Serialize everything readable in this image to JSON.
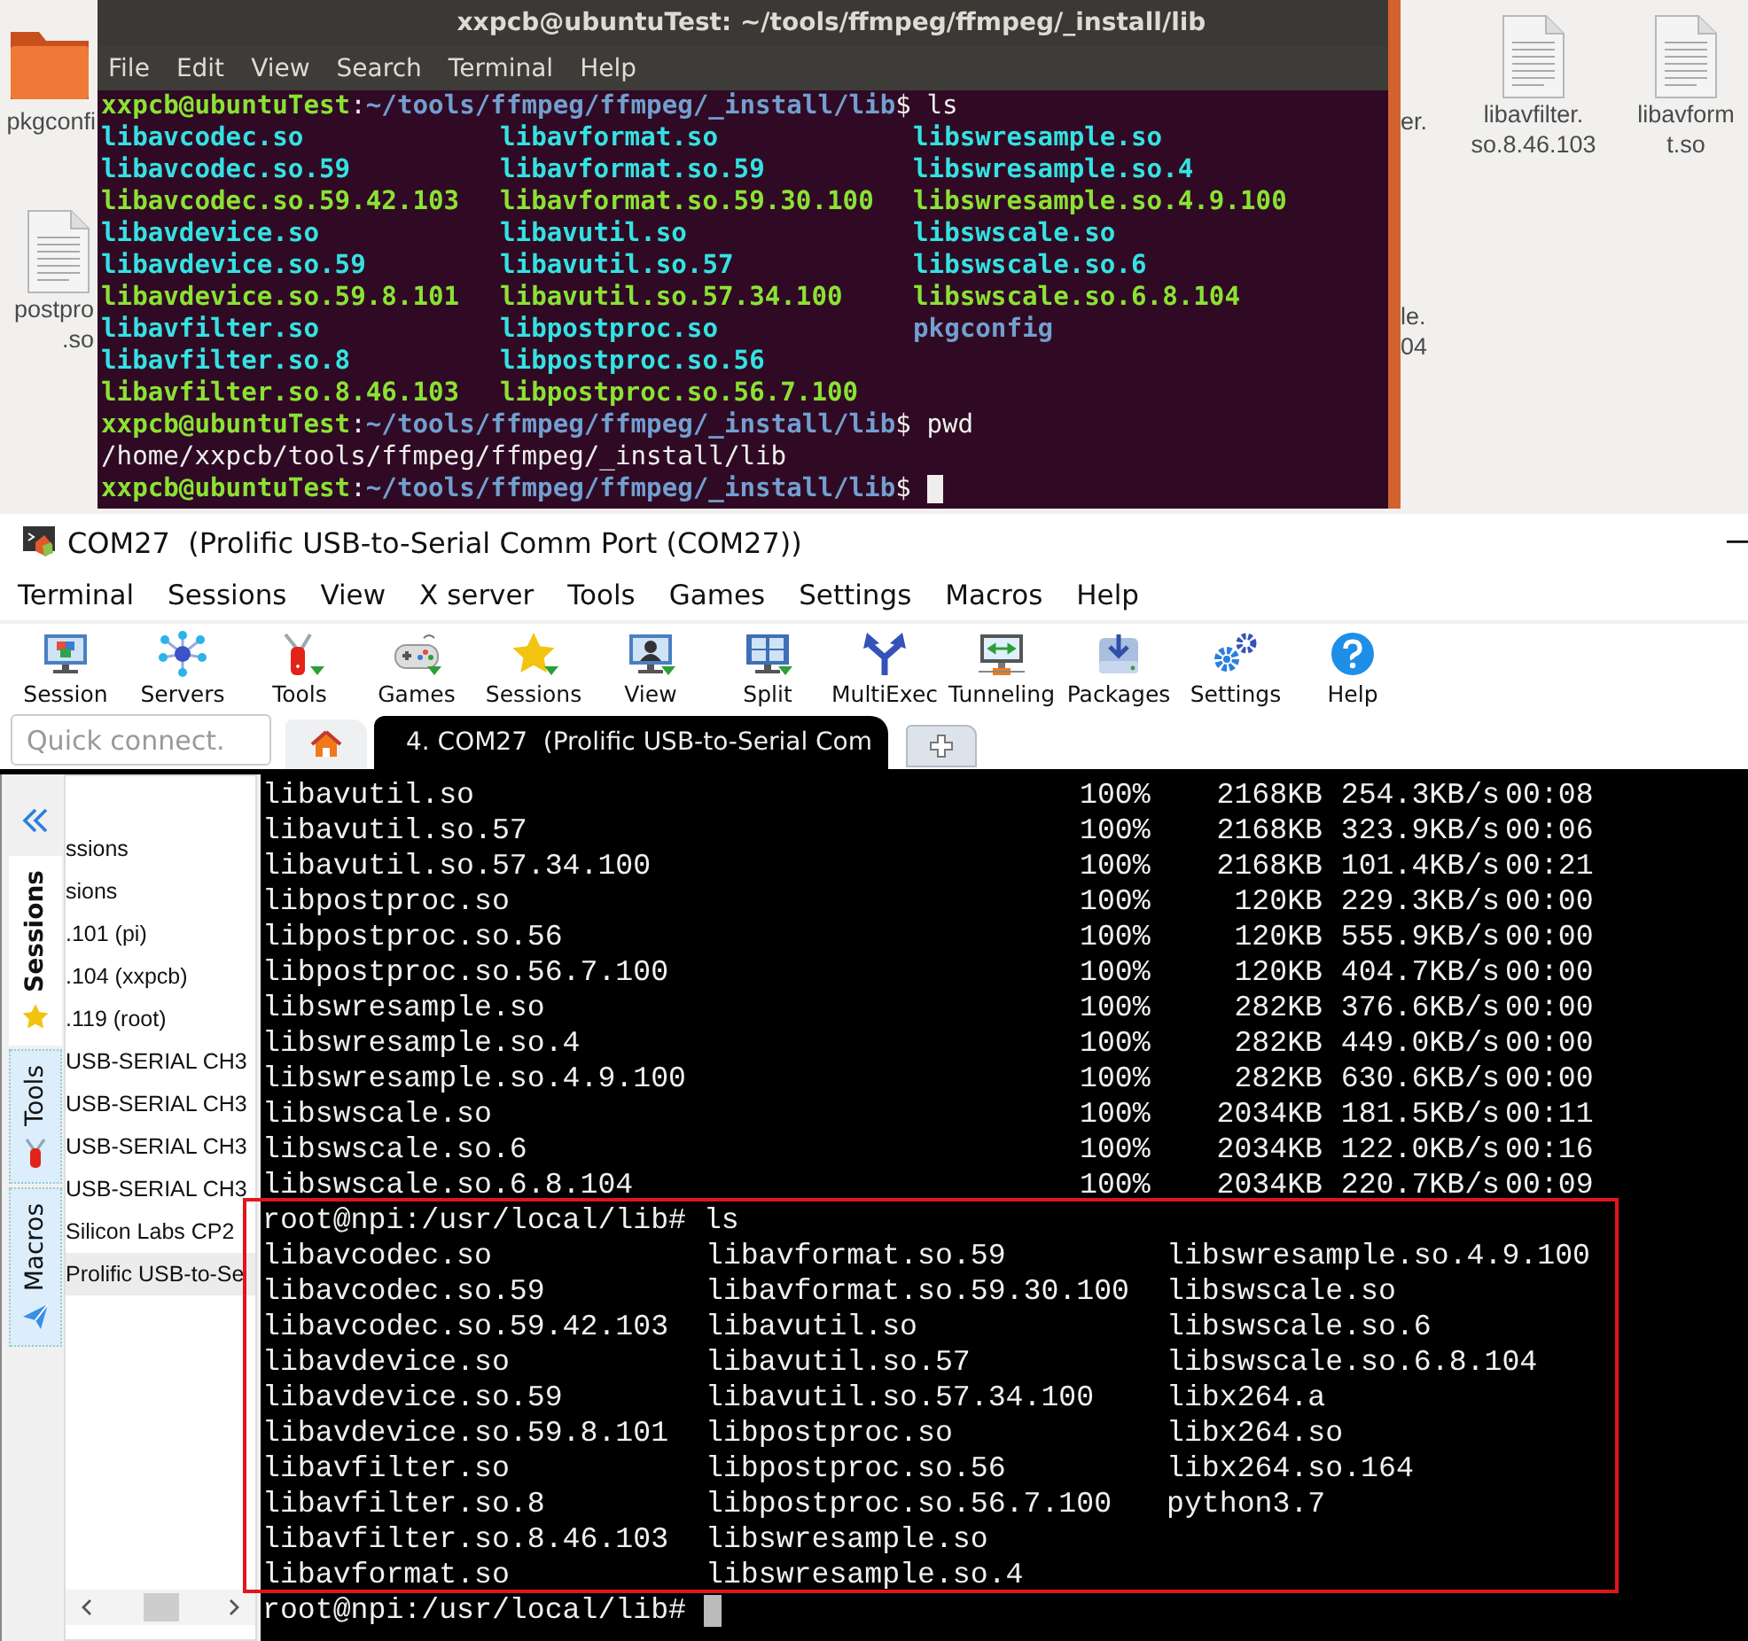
{
  "desktop": {
    "icons": [
      {
        "kind": "folder",
        "lines": [
          "pkgconfi"
        ]
      },
      {
        "kind": "file",
        "lines": [
          "postpro",
          ".so"
        ]
      },
      {
        "kind": "label",
        "lines": [
          "er."
        ]
      },
      {
        "kind": "label",
        "lines": [
          "le.",
          "04"
        ]
      },
      {
        "kind": "file",
        "lines": [
          "libavfilter.",
          "so.8.46.103"
        ]
      },
      {
        "kind": "file",
        "lines": [
          "libavform",
          "t.so"
        ]
      }
    ]
  },
  "ubuntu_terminal": {
    "title": "xxpcb@ubuntuTest: ~/tools/ffmpeg/ffmpeg/_install/lib",
    "menu": [
      "File",
      "Edit",
      "View",
      "Search",
      "Terminal",
      "Help"
    ],
    "lines": [
      {
        "kind": "prompt",
        "segments": [
          {
            "kind": "user",
            "text": "xxpcb@ubuntuTest"
          },
          {
            "kind": "plain",
            "text": ":"
          },
          {
            "kind": "path",
            "text": "~/tools/ffmpeg/ffmpeg/_install/lib"
          },
          {
            "kind": "plain",
            "text": "$ ls"
          }
        ]
      },
      {
        "kind": "files",
        "entries": [
          {
            "name": "libavcodec.so",
            "kind": "link"
          },
          {
            "name": "libavformat.so",
            "kind": "link"
          },
          {
            "name": "libswresample.so",
            "kind": "link"
          }
        ]
      },
      {
        "kind": "files",
        "entries": [
          {
            "name": "libavcodec.so.59",
            "kind": "link"
          },
          {
            "name": "libavformat.so.59",
            "kind": "link"
          },
          {
            "name": "libswresample.so.4",
            "kind": "link"
          }
        ]
      },
      {
        "kind": "files",
        "entries": [
          {
            "name": "libavcodec.so.59.42.103",
            "kind": "file"
          },
          {
            "name": "libavformat.so.59.30.100",
            "kind": "file"
          },
          {
            "name": "libswresample.so.4.9.100",
            "kind": "file"
          }
        ]
      },
      {
        "kind": "files",
        "entries": [
          {
            "name": "libavdevice.so",
            "kind": "link"
          },
          {
            "name": "libavutil.so",
            "kind": "link"
          },
          {
            "name": "libswscale.so",
            "kind": "link"
          }
        ]
      },
      {
        "kind": "files",
        "entries": [
          {
            "name": "libavdevice.so.59",
            "kind": "link"
          },
          {
            "name": "libavutil.so.57",
            "kind": "link"
          },
          {
            "name": "libswscale.so.6",
            "kind": "link"
          }
        ]
      },
      {
        "kind": "files",
        "entries": [
          {
            "name": "libavdevice.so.59.8.101",
            "kind": "file"
          },
          {
            "name": "libavutil.so.57.34.100",
            "kind": "file"
          },
          {
            "name": "libswscale.so.6.8.104",
            "kind": "file"
          }
        ]
      },
      {
        "kind": "files",
        "entries": [
          {
            "name": "libavfilter.so",
            "kind": "link"
          },
          {
            "name": "libpostproc.so",
            "kind": "link"
          },
          {
            "name": "pkgconfig",
            "kind": "dir"
          }
        ]
      },
      {
        "kind": "files",
        "entries": [
          {
            "name": "libavfilter.so.8",
            "kind": "link"
          },
          {
            "name": "libpostproc.so.56",
            "kind": "link"
          }
        ]
      },
      {
        "kind": "files",
        "entries": [
          {
            "name": "libavfilter.so.8.46.103",
            "kind": "file"
          },
          {
            "name": "libpostproc.so.56.7.100",
            "kind": "file"
          }
        ]
      },
      {
        "kind": "prompt",
        "segments": [
          {
            "kind": "user",
            "text": "xxpcb@ubuntuTest"
          },
          {
            "kind": "plain",
            "text": ":"
          },
          {
            "kind": "path",
            "text": "~/tools/ffmpeg/ffmpeg/_install/lib"
          },
          {
            "kind": "plain",
            "text": "$ pwd"
          }
        ]
      },
      {
        "kind": "output",
        "text": "/home/xxpcb/tools/ffmpeg/ffmpeg/_install/lib"
      },
      {
        "kind": "prompt",
        "cursor": true,
        "segments": [
          {
            "kind": "user",
            "text": "xxpcb@ubuntuTest"
          },
          {
            "kind": "plain",
            "text": ":"
          },
          {
            "kind": "path",
            "text": "~/tools/ffmpeg/ffmpeg/_install/lib"
          },
          {
            "kind": "plain",
            "text": "$"
          }
        ]
      }
    ]
  },
  "mobaxterm": {
    "title": "COM27  (Prolific USB-to-Serial Comm Port (COM27))",
    "menu": [
      "Terminal",
      "Sessions",
      "View",
      "X server",
      "Tools",
      "Games",
      "Settings",
      "Macros",
      "Help"
    ],
    "toolbar": [
      "Session",
      "Servers",
      "Tools",
      "Games",
      "Sessions",
      "View",
      "Split",
      "MultiExec",
      "Tunneling",
      "Packages",
      "Settings",
      "Help"
    ],
    "quick_connect": {
      "placeholder": "Quick connect."
    },
    "tabs": [
      {
        "kind": "home",
        "selected": false
      },
      {
        "kind": "session",
        "label": "4. COM27  (Prolific USB-to-Serial Com",
        "selected": true
      }
    ],
    "side_tabs": [
      {
        "label": "Sessions",
        "selected": true
      },
      {
        "label": "Tools",
        "selected": false
      },
      {
        "label": "Macros",
        "selected": false
      }
    ],
    "sessions": [
      {
        "label": "ssions",
        "selected": false
      },
      {
        "label": "sions",
        "selected": false
      },
      {
        "label": ".101 (pi)",
        "selected": false
      },
      {
        "label": ".104 (xxpcb)",
        "selected": false
      },
      {
        "label": ".119 (root)",
        "selected": false
      },
      {
        "label": "USB-SERIAL CH3",
        "selected": false
      },
      {
        "label": "USB-SERIAL CH3",
        "selected": false
      },
      {
        "label": "USB-SERIAL CH3",
        "selected": false
      },
      {
        "label": "USB-SERIAL CH3",
        "selected": false
      },
      {
        "label": "Silicon Labs CP2",
        "selected": false
      },
      {
        "label": "Prolific USB-to-Se",
        "selected": true
      }
    ],
    "terminal": {
      "lines": [
        {
          "kind": "transfer",
          "cells": [
            "libavutil.so",
            "100%",
            "2168KB",
            "254.3KB/s",
            "00:08"
          ]
        },
        {
          "kind": "transfer",
          "cells": [
            "libavutil.so.57",
            "100%",
            "2168KB",
            "323.9KB/s",
            "00:06"
          ]
        },
        {
          "kind": "transfer",
          "cells": [
            "libavutil.so.57.34.100",
            "100%",
            "2168KB",
            "101.4KB/s",
            "00:21"
          ]
        },
        {
          "kind": "transfer",
          "cells": [
            "libpostproc.so",
            "100%",
            "120KB",
            "229.3KB/s",
            "00:00"
          ]
        },
        {
          "kind": "transfer",
          "cells": [
            "libpostproc.so.56",
            "100%",
            "120KB",
            "555.9KB/s",
            "00:00"
          ]
        },
        {
          "kind": "transfer",
          "cells": [
            "libpostproc.so.56.7.100",
            "100%",
            "120KB",
            "404.7KB/s",
            "00:00"
          ]
        },
        {
          "kind": "transfer",
          "cells": [
            "libswresample.so",
            "100%",
            "282KB",
            "376.6KB/s",
            "00:00"
          ]
        },
        {
          "kind": "transfer",
          "cells": [
            "libswresample.so.4",
            "100%",
            "282KB",
            "449.0KB/s",
            "00:00"
          ]
        },
        {
          "kind": "transfer",
          "cells": [
            "libswresample.so.4.9.100",
            "100%",
            "282KB",
            "630.6KB/s",
            "00:00"
          ]
        },
        {
          "kind": "transfer",
          "cells": [
            "libswscale.so",
            "100%",
            "2034KB",
            "181.5KB/s",
            "00:11"
          ]
        },
        {
          "kind": "transfer",
          "cells": [
            "libswscale.so.6",
            "100%",
            "2034KB",
            "122.0KB/s",
            "00:16"
          ]
        },
        {
          "kind": "transfer",
          "cells": [
            "libswscale.so.6.8.104",
            "100%",
            "2034KB",
            "220.7KB/s",
            "00:09"
          ]
        },
        {
          "kind": "prompt",
          "text": "root@npi:/usr/local/lib# ls"
        },
        {
          "kind": "files",
          "entries": [
            "libavcodec.so",
            "libavformat.so.59",
            "libswresample.so.4.9.100"
          ]
        },
        {
          "kind": "files",
          "entries": [
            "libavcodec.so.59",
            "libavformat.so.59.30.100",
            "libswscale.so"
          ]
        },
        {
          "kind": "files",
          "entries": [
            "libavcodec.so.59.42.103",
            "libavutil.so",
            "libswscale.so.6"
          ]
        },
        {
          "kind": "files",
          "entries": [
            "libavdevice.so",
            "libavutil.so.57",
            "libswscale.so.6.8.104"
          ]
        },
        {
          "kind": "files",
          "entries": [
            "libavdevice.so.59",
            "libavutil.so.57.34.100",
            "libx264.a"
          ]
        },
        {
          "kind": "files",
          "entries": [
            "libavdevice.so.59.8.101",
            "libpostproc.so",
            "libx264.so"
          ]
        },
        {
          "kind": "files",
          "entries": [
            "libavfilter.so",
            "libpostproc.so.56",
            "libx264.so.164"
          ]
        },
        {
          "kind": "files",
          "entries": [
            "libavfilter.so.8",
            "libpostproc.so.56.7.100",
            "python3.7"
          ]
        },
        {
          "kind": "files",
          "entries": [
            "libavfilter.so.8.46.103",
            "libswresample.so"
          ]
        },
        {
          "kind": "files",
          "entries": [
            "libavformat.so",
            "libswresample.so.4"
          ]
        },
        {
          "kind": "prompt",
          "text": "root@npi:/usr/local/lib#",
          "cursor": true
        }
      ]
    }
  }
}
